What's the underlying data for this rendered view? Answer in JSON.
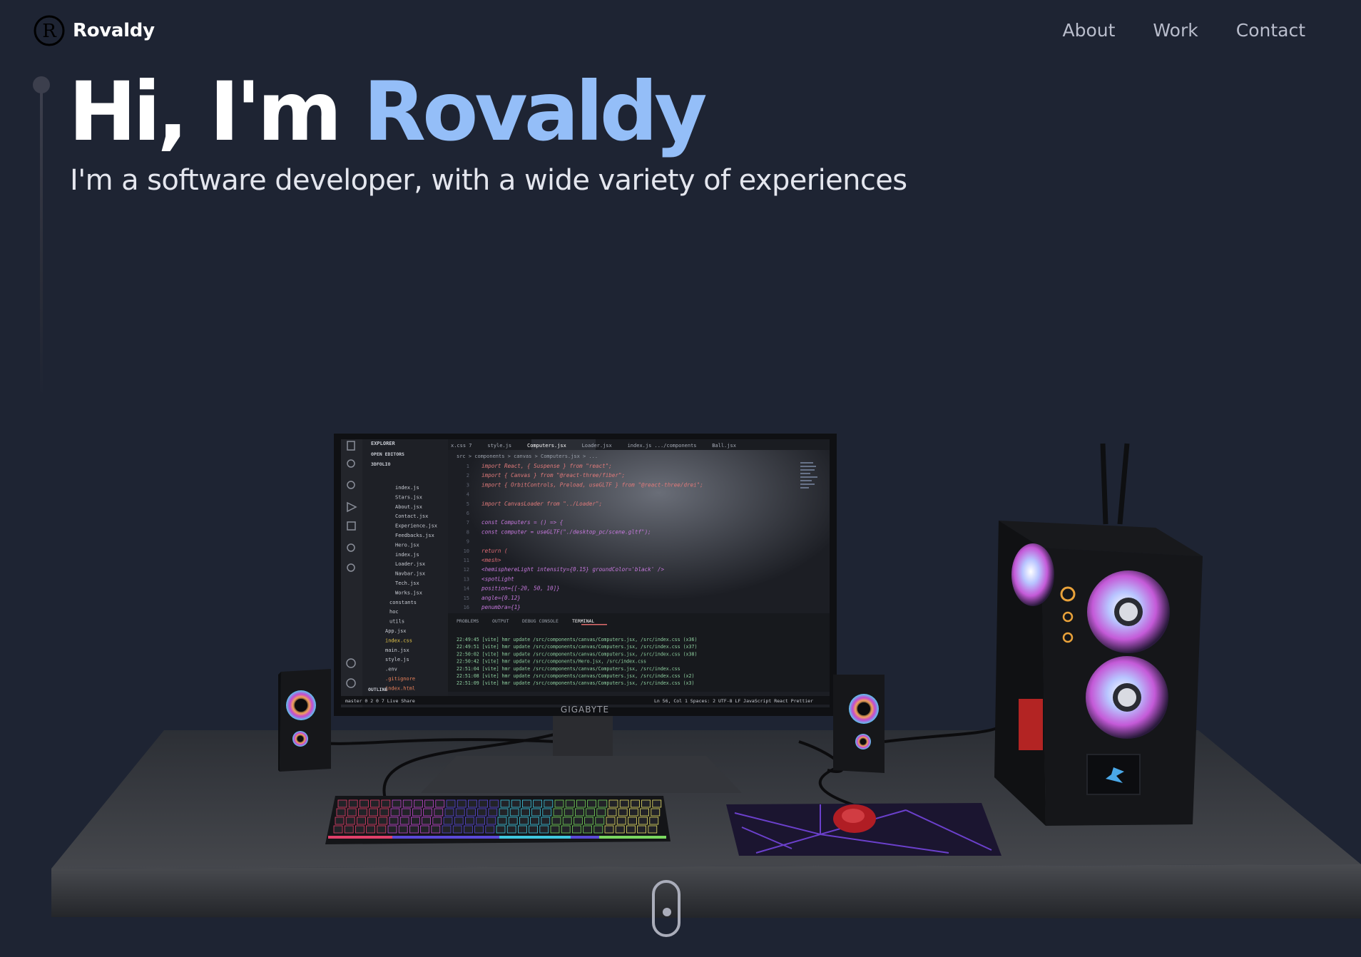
{
  "brand": {
    "name": "Rovaldy",
    "logo_icon": "circled-r-logo"
  },
  "nav": {
    "links": [
      "About",
      "Work",
      "Contact"
    ]
  },
  "hero": {
    "greeting": "Hi, I'm ",
    "name": "Rovaldy",
    "subtitle": "I'm a software developer, with a wide variety of experiences"
  },
  "monitor": {
    "brand_label": "GIGABYTE",
    "tabs": [
      "x.css 7",
      "style.js",
      "Computers.jsx",
      "Loader.jsx",
      "index.js .../components",
      "Ball.jsx"
    ],
    "breadcrumb": "src > components > canvas > Computers.jsx > ...",
    "explorer": {
      "header": "EXPLORER",
      "open_editors": "OPEN EDITORS",
      "project": "3DFOLIO",
      "files": [
        "index.js",
        "Stars.jsx",
        "About.jsx",
        "Contact.jsx",
        "Experience.jsx",
        "Feedbacks.jsx",
        "Hero.jsx",
        "index.js",
        "Loader.jsx",
        "Navbar.jsx",
        "Tech.jsx",
        "Works.jsx",
        "constants",
        "hoc",
        "utils",
        "App.jsx",
        "index.css",
        "main.jsx",
        "style.js",
        ".env",
        ".gitignore",
        "index.html"
      ],
      "outline": "OUTLINE"
    },
    "code_lines": [
      "import React, { Suspense } from \"react\";",
      "import { Canvas } from \"@react-three/fiber\";",
      "import { OrbitControls, Preload, useGLTF } from \"@react-three/drei\";",
      "",
      "import CanvasLoader from \"../Loader\";",
      "",
      "const Computers = () => {",
      "  const computer = useGLTF(\"./desktop_pc/scene.gltf\");",
      "",
      "  return (",
      "    <mesh>",
      "      <hemisphereLight intensity={0.15} groundColor='black' />",
      "      <spotLight",
      "        position={[-20, 50, 10]}",
      "        angle={0.12}",
      "        penumbra={1}"
    ],
    "panel_tabs": [
      "PROBLEMS",
      "OUTPUT",
      "DEBUG CONSOLE",
      "TERMINAL"
    ],
    "terminal_lines": [
      "22:49:45 [vite] hmr update /src/components/canvas/Computers.jsx, /src/index.css (x36)",
      "22:49:51 [vite] hmr update /src/components/canvas/Computers.jsx, /src/index.css (x37)",
      "22:50:02 [vite] hmr update /src/components/canvas/Computers.jsx, /src/index.css (x38)",
      "22:50:42 [vite] hmr update /src/components/Hero.jsx, /src/index.css",
      "22:51:04 [vite] hmr update /src/components/canvas/Computers.jsx, /src/index.css",
      "22:51:08 [vite] hmr update /src/components/canvas/Computers.jsx, /src/index.css (x2)",
      "22:51:09 [vite] hmr update /src/components/canvas/Computers.jsx, /src/index.css (x3)"
    ],
    "status_left": "master  0 2  0 7  Live Share",
    "status_right": "Ln 56, Col 1  Spaces: 2  UTF-8  LF  JavaScript React  Prettier"
  },
  "scroll_indicator_icon": "mouse-scroll-icon",
  "colors": {
    "background": "#1e2433",
    "accent": "#94bef8",
    "nav_text": "#b9bdcc"
  }
}
